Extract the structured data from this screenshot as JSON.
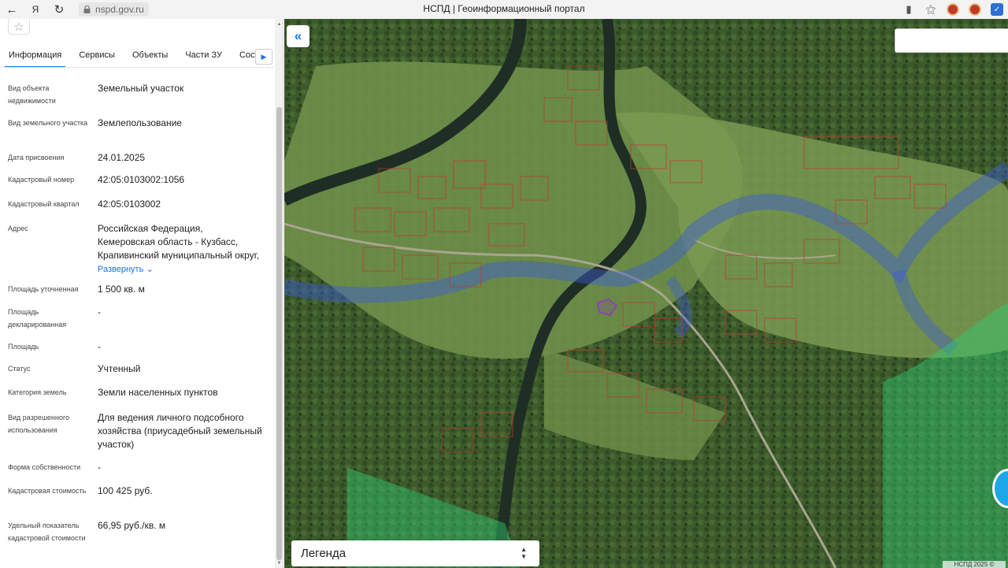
{
  "browser": {
    "url": "nspd.gov.ru",
    "title": "НСПД | Геоинформационный портал"
  },
  "tabs": [
    "Информация",
    "Сервисы",
    "Объекты",
    "Части ЗУ",
    "Соста"
  ],
  "info": {
    "object_type": {
      "label": "Вид объекта недвижимости",
      "value": "Земельный участок"
    },
    "land_type": {
      "label": "Вид земельного участка",
      "value": "Землепользование"
    },
    "assign_date": {
      "label": "Дата присвоения",
      "value": "24.01.2025"
    },
    "cadastral_number": {
      "label": "Кадастровый номер",
      "value": "42:05:0103002:1056"
    },
    "cadastral_quarter": {
      "label": "Кадастровый квартал",
      "value": "42:05:0103002"
    },
    "address": {
      "label": "Адрес",
      "lines": [
        "Российская Федерация,",
        "Кемеровская область - Кузбасс,",
        "Крапивинский муниципальный округ,"
      ],
      "expand": "Развернуть"
    },
    "area_specified": {
      "label": "Площадь уточненная",
      "value": "1 500 кв. м"
    },
    "area_declared": {
      "label": "Площадь декларированная",
      "value": "-"
    },
    "area": {
      "label": "Площадь",
      "value": "-"
    },
    "status": {
      "label": "Статус",
      "value": "Учтенный"
    },
    "land_category": {
      "label": "Категория земель",
      "value": "Земли населенных пунктов"
    },
    "permitted_use": {
      "label": "Вид разрешенного использования",
      "value": "Для ведения личного подсобного хозяйства (приусадебный земельный участок)"
    },
    "ownership_form": {
      "label": "Форма собственности",
      "value": "-"
    },
    "cadastral_value": {
      "label": "Кадастровая стоимость",
      "value": "100 425 руб."
    },
    "specific_value": {
      "label": "Удельный показатель кадастровой стоимости",
      "value": "66,95 руб./кв. м"
    }
  },
  "map": {
    "legend_label": "Легенда",
    "copyright": "НСПД 2025 ©"
  },
  "icons": {
    "back": "back-arrow-icon",
    "yandex": "yandex-icon",
    "reload": "reload-icon",
    "lock": "lock-icon",
    "bookmark": "bookmark-icon",
    "extensions": "extensions-icon",
    "favorite": "star-icon",
    "collapse": "double-chevron-left-icon",
    "chat": "chat-icon"
  },
  "colors": {
    "accent": "#1a73e8",
    "parcel_outline": "#c0392b",
    "highlight_parcel": "#8e44ad",
    "water_zone": "#3b5bd6",
    "forest_zone": "#2ecc71"
  }
}
